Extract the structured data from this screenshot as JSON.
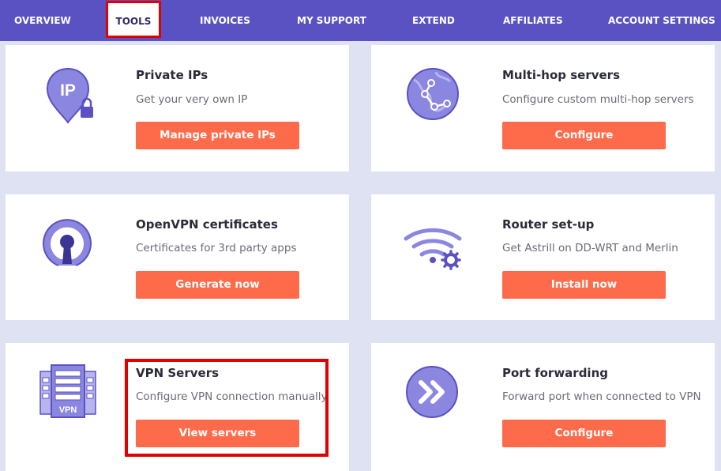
{
  "nav": {
    "items": [
      {
        "label": "OVERVIEW"
      },
      {
        "label": "TOOLS"
      },
      {
        "label": "INVOICES"
      },
      {
        "label": "MY SUPPORT"
      },
      {
        "label": "EXTEND"
      },
      {
        "label": "AFFILIATES"
      },
      {
        "label": "ACCOUNT SETTINGS"
      }
    ],
    "active": "TOOLS"
  },
  "cards": {
    "private_ips": {
      "title": "Private IPs",
      "desc": "Get your very own IP",
      "button": "Manage private IPs",
      "icon": "ip-location-lock-icon",
      "icon_text": "IP"
    },
    "multihop": {
      "title": "Multi-hop servers",
      "desc": "Configure custom multi-hop servers",
      "button": "Configure",
      "icon": "globe-network-icon"
    },
    "openvpn": {
      "title": "OpenVPN certificates",
      "desc": "Certificates for 3rd party apps",
      "button": "Generate now",
      "icon": "keyhole-icon"
    },
    "router": {
      "title": "Router set-up",
      "desc": "Get Astrill on DD-WRT and Merlin",
      "button": "Install now",
      "icon": "wifi-gear-icon"
    },
    "vpn_servers": {
      "title": "VPN Servers",
      "desc": "Configure VPN connection manually",
      "button": "View servers",
      "icon": "server-rack-icon",
      "icon_text": "VPN"
    },
    "port_forwarding": {
      "title": "Port forwarding",
      "desc": "Forward port when connected to VPN",
      "button": "Configure",
      "icon": "double-chevron-right-icon"
    }
  },
  "colors": {
    "nav_bg": "#5a52c3",
    "page_bg": "#dfe2f3",
    "button": "#fe6b4a",
    "highlight": "#e00000",
    "icon_fill": "#8b86e0",
    "icon_stroke": "#5a52c3"
  }
}
